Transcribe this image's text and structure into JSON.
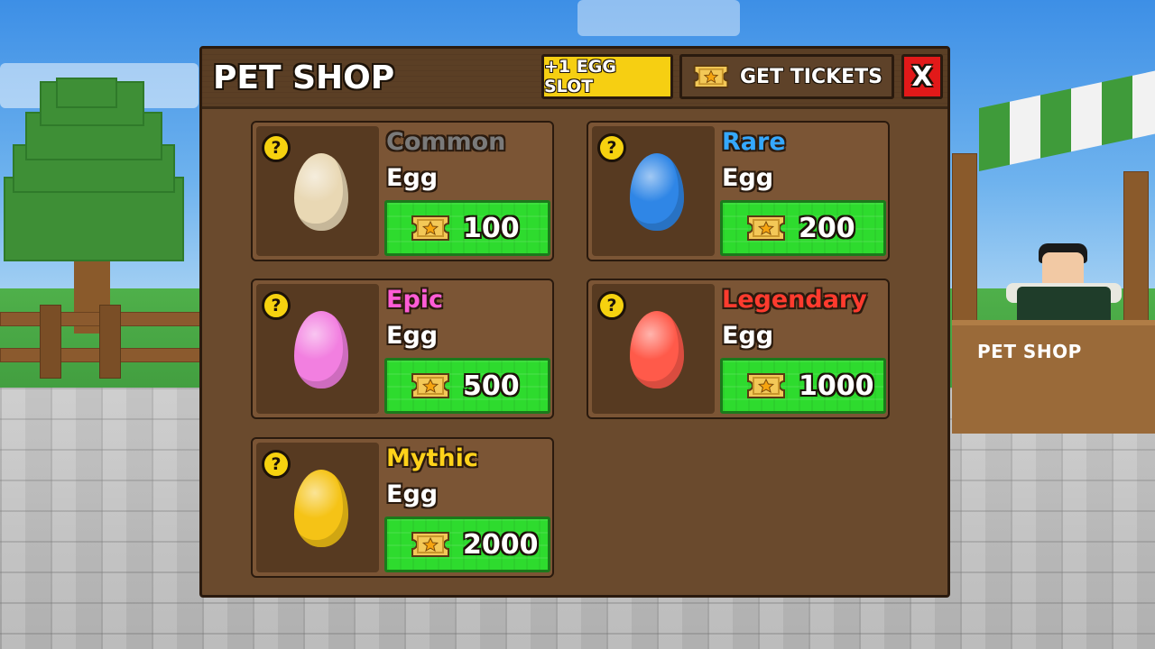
{
  "background": {
    "stall_sign": "PET SHOP"
  },
  "shop": {
    "title": "PET SHOP",
    "egg_slot_label": "+1 EGG SLOT",
    "get_tickets_label": "GET TICKETS",
    "close_label": "X",
    "info_symbol": "?",
    "currency_icon": "ticket-icon",
    "eggs": [
      {
        "rarity": "Common",
        "label": "Egg",
        "price": "100",
        "rarity_color": "#7a7a7a",
        "egg_color": "#e9d8b4"
      },
      {
        "rarity": "Rare",
        "label": "Egg",
        "price": "200",
        "rarity_color": "#35a8ff",
        "egg_color": "#2f86e6"
      },
      {
        "rarity": "Epic",
        "label": "Egg",
        "price": "500",
        "rarity_color": "#ff5cd6",
        "egg_color": "#f27fe0"
      },
      {
        "rarity": "Legendary",
        "label": "Egg",
        "price": "1000",
        "rarity_color": "#ff3b2e",
        "egg_color": "#ff5a4a"
      },
      {
        "rarity": "Mythic",
        "label": "Egg",
        "price": "2000",
        "rarity_color": "#ffd21a",
        "egg_color": "#f5c316"
      }
    ]
  }
}
